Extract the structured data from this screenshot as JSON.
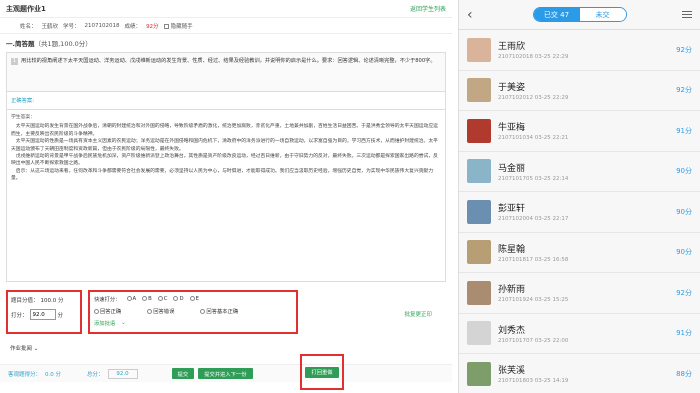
{
  "left": {
    "title": "主观题作业1",
    "back_link": "返回学生列表",
    "student": {
      "name_label": "姓名：",
      "name": "王鹤欣",
      "id_label": "学号：",
      "id": "2107102018",
      "score_label": "成绩：",
      "score": "92分",
      "hide_mode": "隐藏随手"
    },
    "question_header": "一.简答题",
    "question_header_sub": "（共1题,100.0分）",
    "question_number": "1",
    "question_text": "用比较的视角阐述下太平天国运动、洋务运动、戊戌维新运动的发生背景、性质、经过、结果及经验教训，并说明你的启示是什么。要求：回答逻辑、论述清晰完整，不少于800字。",
    "correct_answer_label": "正确答案:",
    "student_answer_label": "学生答案：",
    "answer_paragraphs": [
      "太平天国运动的发生背景在国外战争后，清朝的封建统治和对外国的侵略，导致阶级矛盾的激化，统治更加腐败，赤贫化严重，土地兼并加剧，百姓生活日益困苦。于是洪秀全领导的太平天国运动应运而生，主要反映出农民阶级的斗争精神。",
      "太平天国运动的性质是一场具有资本主义因素的农民运动；洋务运动是在外国侵略和国内危机下，清政府中的洋务派进行的一场自救运动，以求富自强为目的，学习西方技术，从而维护封建统治。太平天国运动颁布了天朝田亩制度和资政新篇，但由于农民阶级的局限性，最终失败。",
      "戊戌维新运动的背景是甲午战争后民族危机加深，资产阶级维新派登上政治舞台。其性质是资产阶级改良运动，经过百日维新，由于守旧势力的反对，最终失败。三次运动都是探索国家出路的尝试，反映出中国人民不断探索救国之路。",
      "启示：从这三场运动来看，任何改革和斗争都需要符合社会发展的需要，必须坚持以人民为中心，与时俱进，才能取得成功。我们应当汲取历史经验，增强历史自觉，为实现中华民族伟大复兴贡献力量。"
    ],
    "score_box": {
      "total_label": "题目分值：",
      "total": "100.0 分",
      "score_label": "打分：",
      "score_value": "92.0",
      "unit": "分"
    },
    "quick_box": {
      "quick_label": "快速打分：",
      "options": [
        "A",
        "B",
        "C",
        "D",
        "E"
      ],
      "criteria": [
        "回答正确",
        "回答错误",
        "回答基本正确"
      ],
      "add_comment": "添加批语"
    },
    "modify_link": "批复更正印",
    "work_type": "作业批阅",
    "bottom": {
      "objective_label": "客观题得分：",
      "objective_score": "0.0 分",
      "total_label": "总分：",
      "total_score": "92.0",
      "btn_submit": "提交",
      "btn_submit_next": "提交并进入下一份",
      "btn_return": "打回重做"
    }
  },
  "right": {
    "tabs": {
      "done": "已交 47",
      "undone": "未交"
    },
    "students": [
      {
        "name": "王雨欣",
        "sub": "2107102018  03-25 22:29",
        "score": "92分",
        "avatar": "#d9b49a"
      },
      {
        "name": "于美姿",
        "sub": "2107102012  03-25 22:29",
        "score": "92分",
        "avatar": "#c2a785"
      },
      {
        "name": "牛亚梅",
        "sub": "2107101034  03-25 22:21",
        "score": "91分",
        "avatar": "#b03a2e"
      },
      {
        "name": "马金丽",
        "sub": "2107101705  03-25 22:14",
        "score": "90分",
        "avatar": "#8ab5c9"
      },
      {
        "name": "彭亚轩",
        "sub": "2107102004  03-25 22:17",
        "score": "90分",
        "avatar": "#6a8fb0"
      },
      {
        "name": "陈星翰",
        "sub": "2107101817  03-25 16:58",
        "score": "90分",
        "avatar": "#b89e74"
      },
      {
        "name": "孙新雨",
        "sub": "2107101924  03-25 15:25",
        "score": "92分",
        "avatar": "#a98c72"
      },
      {
        "name": "刘秀杰",
        "sub": "2107101707  03-25 22:00",
        "score": "91分",
        "avatar": "#d4d4d4"
      },
      {
        "name": "张芙溪",
        "sub": "2107101803  03-25 14:19",
        "score": "88分",
        "avatar": "#7d9d6a"
      }
    ]
  },
  "colors": {
    "accent_green": "#2e9e57",
    "red_highlight": "#e03030",
    "blue": "#2b9be8"
  }
}
